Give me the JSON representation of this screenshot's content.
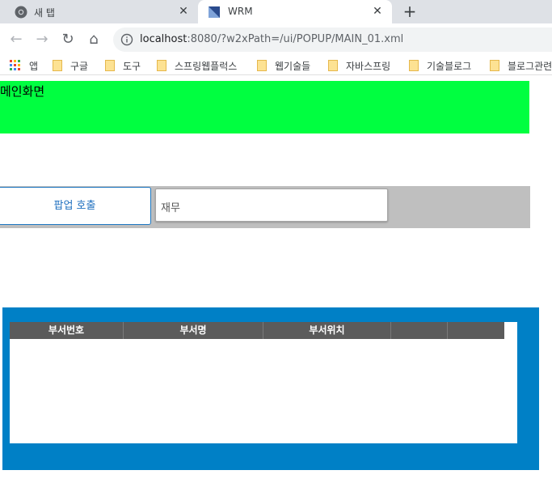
{
  "browser": {
    "tabs": [
      {
        "title": "새 탭",
        "close": "✕"
      },
      {
        "title": "WRM",
        "close": "✕"
      }
    ],
    "new_tab": "+",
    "nav": {
      "back": "←",
      "forward": "→",
      "reload": "↻",
      "home": "⌂"
    },
    "url": {
      "host": "localhost",
      "rest": ":8080/?w2xPath=/ui/POPUP/MAIN_01.xml"
    },
    "bookmarks": {
      "apps": "앱",
      "folders": [
        "구글",
        "도구",
        "스프링웹플럭스",
        "웹기술들",
        "자바스프링",
        "기술블로그",
        "블로그관련"
      ]
    }
  },
  "page": {
    "header_text": "메인화면",
    "popup_button_label": "팝업 호출",
    "dept_input_value": "재무",
    "grid": {
      "columns": [
        "부서번호",
        "부서명",
        "부서위치",
        "",
        ""
      ]
    }
  },
  "colors": {
    "header_green": "#00ff40",
    "grid_panel_blue": "#0080c6",
    "grid_header_gray": "#5b5b5b",
    "controls_gray": "#bfbfbf"
  }
}
